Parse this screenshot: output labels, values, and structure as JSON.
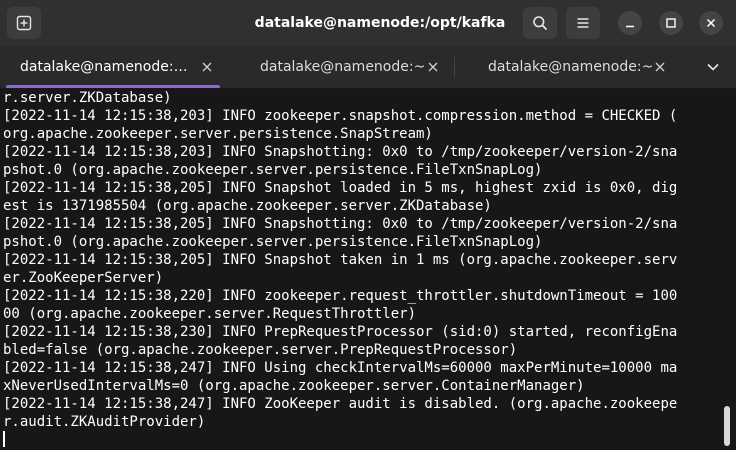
{
  "window": {
    "title": "datalake@namenode:/opt/kafka"
  },
  "tabs": [
    {
      "label": "datalake@namenode:…",
      "active": true
    },
    {
      "label": "datalake@namenode:~",
      "active": false
    },
    {
      "label": "datalake@namenode:~",
      "active": false
    }
  ],
  "icons": {
    "new_tab": "new-tab-icon",
    "search": "search-icon",
    "menu": "hamburger-menu-icon",
    "minimize": "minimize-icon",
    "maximize": "maximize-icon",
    "close": "close-icon",
    "tab_close": "close-icon",
    "tabs_menu": "chevron-down-icon"
  },
  "colors": {
    "accent": "#8c6bc7",
    "headerbar": "#303030",
    "terminal_bg": "#171717",
    "terminal_fg": "#ffffff"
  },
  "terminal": {
    "lines": [
      "r.server.ZKDatabase)",
      "[2022-11-14 12:15:38,203] INFO zookeeper.snapshot.compression.method = CHECKED (",
      "org.apache.zookeeper.server.persistence.SnapStream)",
      "[2022-11-14 12:15:38,203] INFO Snapshotting: 0x0 to /tmp/zookeeper/version-2/sna",
      "pshot.0 (org.apache.zookeeper.server.persistence.FileTxnSnapLog)",
      "[2022-11-14 12:15:38,205] INFO Snapshot loaded in 5 ms, highest zxid is 0x0, dig",
      "est is 1371985504 (org.apache.zookeeper.server.ZKDatabase)",
      "[2022-11-14 12:15:38,205] INFO Snapshotting: 0x0 to /tmp/zookeeper/version-2/sna",
      "pshot.0 (org.apache.zookeeper.server.persistence.FileTxnSnapLog)",
      "[2022-11-14 12:15:38,205] INFO Snapshot taken in 1 ms (org.apache.zookeeper.serv",
      "er.ZooKeeperServer)",
      "[2022-11-14 12:15:38,220] INFO zookeeper.request_throttler.shutdownTimeout = 100",
      "00 (org.apache.zookeeper.server.RequestThrottler)",
      "[2022-11-14 12:15:38,230] INFO PrepRequestProcessor (sid:0) started, reconfigEna",
      "bled=false (org.apache.zookeeper.server.PrepRequestProcessor)",
      "[2022-11-14 12:15:38,247] INFO Using checkIntervalMs=60000 maxPerMinute=10000 ma",
      "xNeverUsedIntervalMs=0 (org.apache.zookeeper.server.ContainerManager)",
      "[2022-11-14 12:15:38,247] INFO ZooKeeper audit is disabled. (org.apache.zookeepe",
      "r.audit.ZKAuditProvider)"
    ]
  }
}
